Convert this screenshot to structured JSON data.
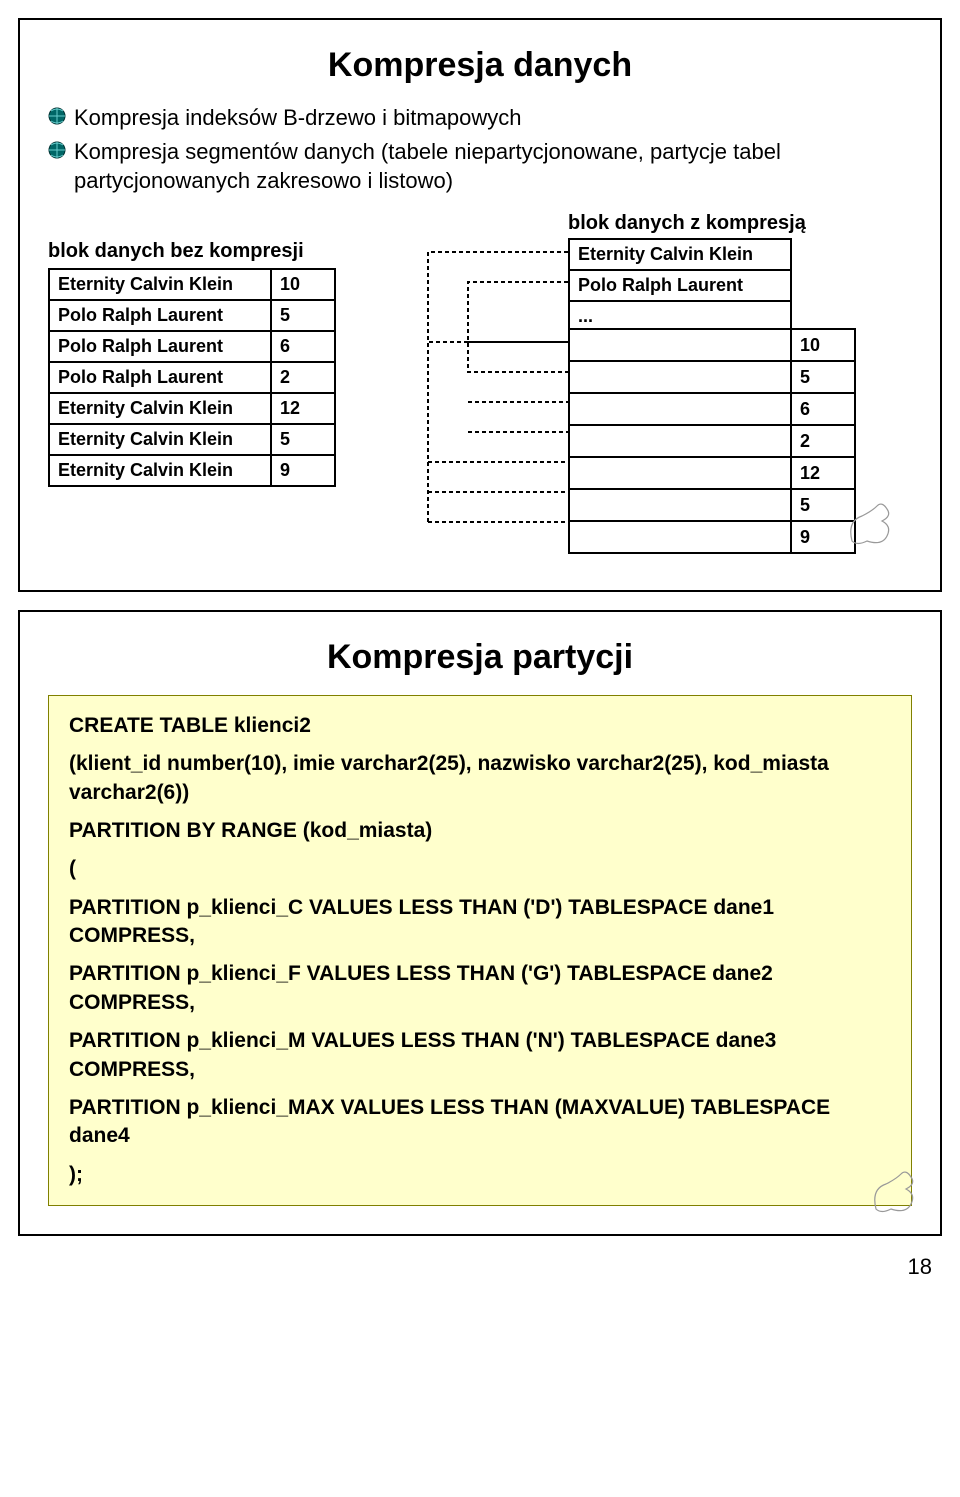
{
  "slide1": {
    "title": "Kompresja danych",
    "bullets": [
      "Kompresja indeksów B-drzewo i bitmapowych",
      "Kompresja segmentów danych (tabele niepartycjonowane, partycje tabel partycjonowanych zakresowo i listowo)"
    ],
    "diagram": {
      "caption_left": "blok danych bez kompresji",
      "caption_right": "blok danych z kompresją",
      "left_rows": [
        {
          "text": "Eternity Calvin Klein",
          "val": "10"
        },
        {
          "text": "Polo Ralph Laurent",
          "val": "5"
        },
        {
          "text": "Polo Ralph Laurent",
          "val": "6"
        },
        {
          "text": "Polo Ralph Laurent",
          "val": "2"
        },
        {
          "text": "Eternity Calvin Klein",
          "val": "12"
        },
        {
          "text": "Eternity Calvin Klein",
          "val": "5"
        },
        {
          "text": "Eternity Calvin Klein",
          "val": "9"
        }
      ],
      "right_symbols": [
        "Eternity Calvin Klein",
        "Polo Ralph Laurent",
        "..."
      ],
      "right_vals": [
        "10",
        "5",
        "6",
        "2",
        "12",
        "5",
        "9"
      ]
    }
  },
  "slide2": {
    "title": "Kompresja partycji",
    "code": {
      "l1": "CREATE TABLE klienci2",
      "l2": "(klient_id number(10), imie varchar2(25), nazwisko varchar2(25), kod_miasta varchar2(6))",
      "l3": "PARTITION BY RANGE (kod_miasta)",
      "l4": "(",
      "l5": "PARTITION p_klienci_C VALUES LESS THAN ('D') TABLESPACE dane1 COMPRESS,",
      "l6": "PARTITION p_klienci_F VALUES LESS THAN ('G') TABLESPACE dane2 COMPRESS,",
      "l7": "PARTITION p_klienci_M VALUES LESS THAN ('N') TABLESPACE dane3 COMPRESS,",
      "l8": "PARTITION p_klienci_MAX VALUES LESS THAN (MAXVALUE) TABLESPACE dane4",
      "l9": ");"
    }
  },
  "page_number": "18"
}
